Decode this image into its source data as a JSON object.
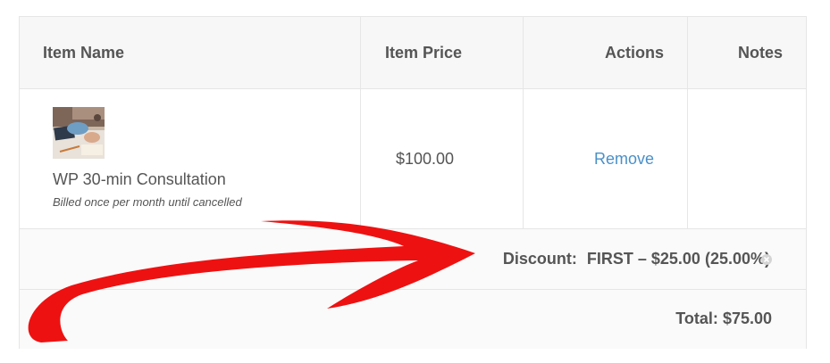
{
  "table": {
    "headers": {
      "item_name": "Item Name",
      "item_price": "Item Price",
      "actions": "Actions",
      "notes": "Notes"
    },
    "item": {
      "name": "WP 30-min Consultation",
      "billing_note": "Billed once per month until cancelled",
      "price": "$100.00",
      "action_label": "Remove",
      "notes": ""
    },
    "discount": {
      "label": "Discount:",
      "code": "FIRST",
      "separator": "–",
      "amount": "$25.00",
      "percent": "(25.00%)",
      "remove_icon": "circle-x-icon"
    },
    "total": {
      "label": "Total:",
      "value": "$75.00"
    }
  },
  "colors": {
    "link": "#4a90c8",
    "annotation_arrow": "#ee1111",
    "header_bg": "#f7f7f7",
    "border": "#e6e6e6"
  }
}
